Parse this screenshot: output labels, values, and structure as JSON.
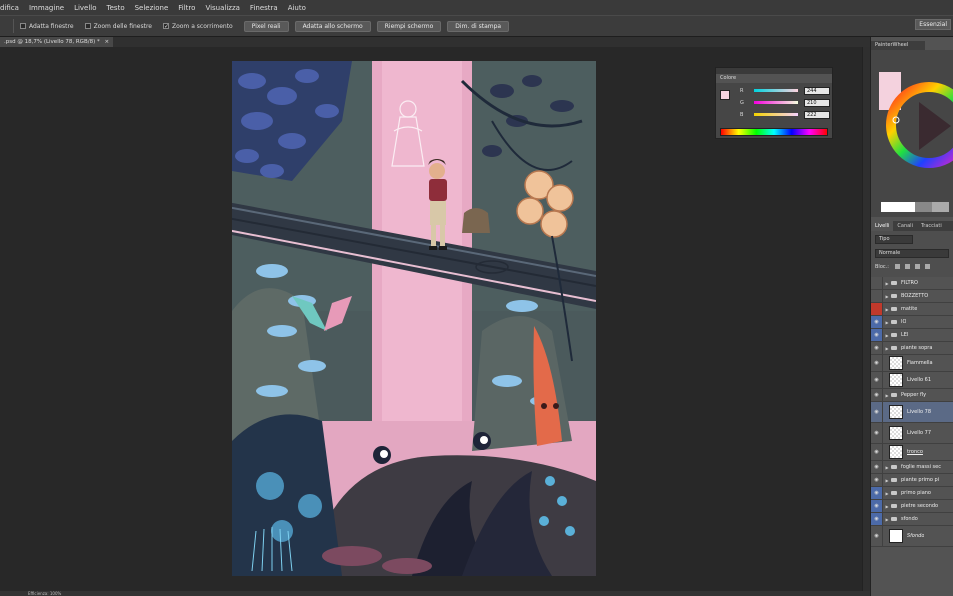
{
  "menu": [
    "difica",
    "Immagine",
    "Livello",
    "Testo",
    "Selezione",
    "Filtro",
    "Visualizza",
    "Finestra",
    "Aiuto"
  ],
  "options": {
    "checks": [
      {
        "label": "Adatta finestre",
        "checked": false
      },
      {
        "label": "Zoom delle finestre",
        "checked": false
      },
      {
        "label": "Zoom a scorrimento",
        "checked": true
      }
    ],
    "buttons": [
      "Pixel reali",
      "Adatta allo schermo",
      "Riempi schermo",
      "Dim. di stampa"
    ],
    "workspace_button": "Essenzial"
  },
  "document_tab": ".psd @ 18,7% (Livello 78, RGB/8) *",
  "doc_tab_close": "×",
  "status": "Efficienza: 100%",
  "color_panel": {
    "title": "Colore",
    "channels": [
      {
        "label": "R",
        "value": "244"
      },
      {
        "label": "G",
        "value": "210"
      },
      {
        "label": "B",
        "value": "222"
      }
    ],
    "colors": {
      "foreground": "#f4d2de",
      "background": "#ffffff"
    }
  },
  "painter_wheel": {
    "title": "PainterWheel",
    "color": "#f4d2de"
  },
  "layers_panel": {
    "tabs": [
      "Livelli",
      "Canali",
      "Tracciati"
    ],
    "kind_filter": "Tipo",
    "blend_mode": "Normale",
    "lock_label": "Bloc.:",
    "layers": [
      {
        "name": "FILTRO",
        "group": true,
        "visible": false
      },
      {
        "name": "BOZZETTO",
        "group": true,
        "visible": false
      },
      {
        "name": "matite",
        "group": true,
        "visible": false,
        "color": "#c0392b"
      },
      {
        "name": "IO",
        "group": true,
        "visible": true,
        "highlight": true
      },
      {
        "name": "LEI",
        "group": true,
        "visible": true,
        "highlight": true
      },
      {
        "name": "piante sopra",
        "group": true,
        "visible": true
      },
      {
        "name": "Fiammella",
        "group": false,
        "visible": true
      },
      {
        "name": "Livello 61",
        "group": false,
        "visible": true
      },
      {
        "name": "Pepper fly",
        "group": true,
        "visible": true
      },
      {
        "name": "Livello 78",
        "group": false,
        "visible": true,
        "selected": true
      },
      {
        "name": "Livello 77",
        "group": false,
        "visible": true
      },
      {
        "name": "tronco",
        "group": false,
        "visible": true
      },
      {
        "name": "foglie massi sec",
        "group": true,
        "visible": true
      },
      {
        "name": "piante primo pi",
        "group": true,
        "visible": true
      },
      {
        "name": "primo piano",
        "group": true,
        "visible": true,
        "highlight": true
      },
      {
        "name": "pietre secondo",
        "group": true,
        "visible": true,
        "highlight": true
      },
      {
        "name": "sfondo",
        "group": true,
        "visible": true,
        "highlight": true
      },
      {
        "name": "Sfondo",
        "group": false,
        "visible": true,
        "italic": true
      }
    ]
  }
}
